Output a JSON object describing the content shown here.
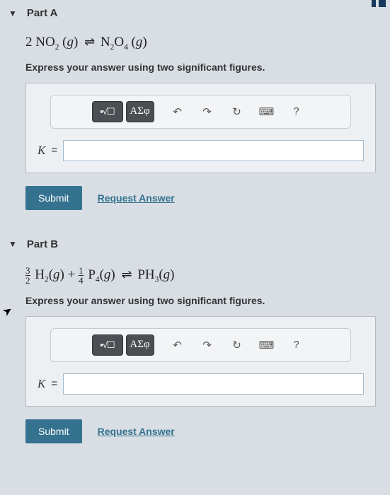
{
  "parts": [
    {
      "title": "Part A",
      "equation_html": "2 NO<sub>2</sub> (<i>g</i>) <span class='eq'>⇌</span> N<sub>2</sub>O<sub>4</sub> (<i>g</i>)",
      "instruction": "Express your answer using two significant figures.",
      "var_label": "K",
      "eq_sign": "=",
      "toolbar": {
        "format_btn": "▪√☐",
        "greek_btn": "ΑΣφ",
        "undo": "↶",
        "redo": "↷",
        "reset": "↻",
        "keyboard": "⌨",
        "help": "?"
      },
      "answer_value": "",
      "submit_label": "Submit",
      "request_label": "Request Answer"
    },
    {
      "title": "Part B",
      "equation_html": "<span class='frac'><span class='num'>3</span><span class='den'>2</span></span> H<sub>2</sub>(<i>g</i>) + <span class='frac'><span class='num'>1</span><span class='den'>4</span></span> P<sub>4</sub>(<i>g</i>) <span class='eq'>⇌</span> PH<sub>3</sub>(<i>g</i>)",
      "instruction": "Express your answer using two significant figures.",
      "var_label": "K",
      "eq_sign": "=",
      "toolbar": {
        "format_btn": "▪√☐",
        "greek_btn": "ΑΣφ",
        "undo": "↶",
        "redo": "↷",
        "reset": "↻",
        "keyboard": "⌨",
        "help": "?"
      },
      "answer_value": "",
      "submit_label": "Submit",
      "request_label": "Request Answer"
    }
  ]
}
